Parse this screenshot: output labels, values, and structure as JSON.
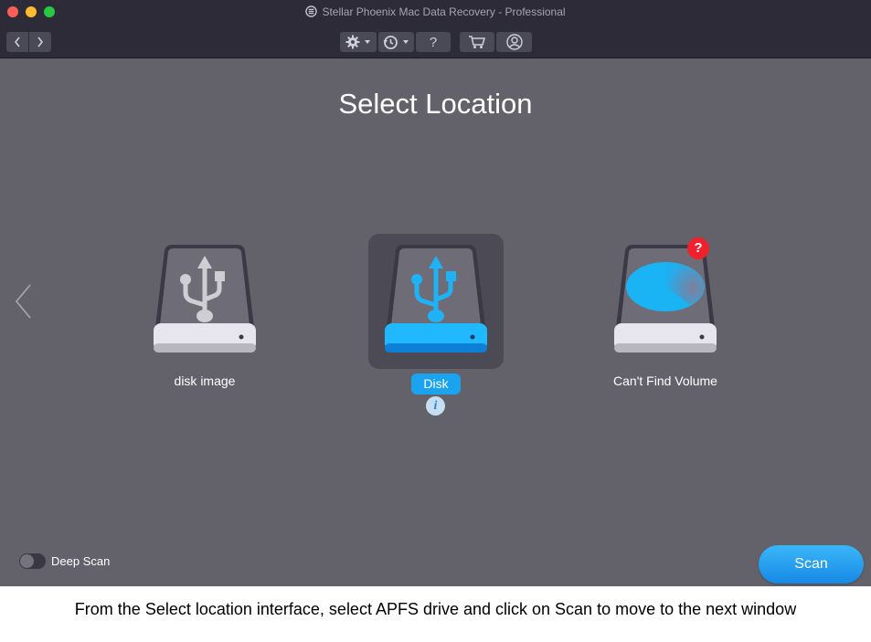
{
  "window": {
    "title": "Stellar Phoenix Mac Data Recovery - Professional"
  },
  "toolbar": {
    "help_label": "?"
  },
  "main": {
    "heading": "Select Location",
    "drives": [
      {
        "label": "disk image",
        "icon": "usb-drive-icon",
        "selected": false
      },
      {
        "label": "Disk",
        "icon": "usb-drive-icon",
        "selected": true
      },
      {
        "label": "Can't Find Volume",
        "icon": "pie-drive-icon",
        "selected": false,
        "badge": "?"
      }
    ],
    "info_glyph": "i"
  },
  "footer": {
    "deep_scan_label": "Deep Scan",
    "deep_scan_on": false,
    "scan_label": "Scan"
  },
  "caption": "From the Select location interface, select APFS drive and click on Scan to move to the next window",
  "colors": {
    "window_bg": "#63626a",
    "titlebar_bg": "#2c2b37",
    "accent": "#1aa4f0",
    "badge_red": "#f0202c"
  }
}
